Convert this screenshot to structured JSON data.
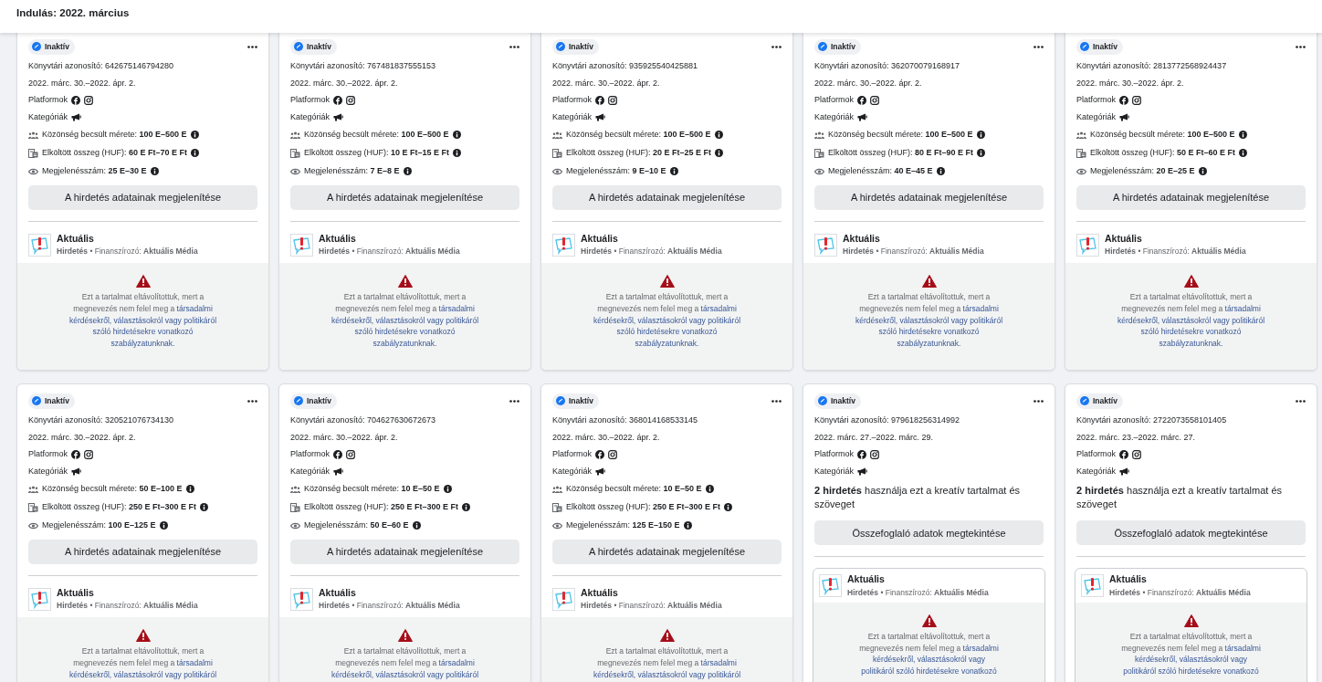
{
  "header": {
    "title": "Indulás: 2022. március"
  },
  "cards": [
    {
      "kind": "details",
      "status": "Inaktív",
      "library_id": "Könyvtári azonosító: 642675146794280",
      "dates": "2022. márc. 30.–2022. ápr. 2.",
      "platforms_label": "Platformok",
      "categories_label": "Kategóriák",
      "metrics": [
        {
          "kind": "audience",
          "text": "Közönség becsült mérete: **100 E–500 E**"
        },
        {
          "kind": "spend",
          "text": "Elköltött összeg (HUF): **60 E Ft–70 E Ft**"
        },
        {
          "kind": "impressions",
          "text": "Megjelenésszám: **25 E–30 E**"
        }
      ],
      "button": "A hirdetés adatainak megjelenítése",
      "advertiser": {
        "name": "Aktuális",
        "line": "**Hirdetés** • Finanszírozó: **Aktuális Média**"
      },
      "notice": [
        {
          "text": "Ezt a tartalmat eltávolítottuk, mert a"
        },
        {
          "text": "megnevezés nem felel meg a",
          "link": "társadalmi"
        },
        {
          "link": "kérdésekről, választásokról vagy politikáról"
        },
        {
          "link": "szóló hirdetésekre vonatkozó"
        },
        {
          "link": "szabályzatunknak."
        }
      ]
    },
    {
      "kind": "details",
      "status": "Inaktív",
      "library_id": "Könyvtári azonosító: 767481837555153",
      "dates": "2022. márc. 30.–2022. ápr. 2.",
      "platforms_label": "Platformok",
      "categories_label": "Kategóriák",
      "metrics": [
        {
          "kind": "audience",
          "text": "Közönség becsült mérete: **100 E–500 E**"
        },
        {
          "kind": "spend",
          "text": "Elköltött összeg (HUF): **10 E Ft–15 E Ft**"
        },
        {
          "kind": "impressions",
          "text": "Megjelenésszám: **7 E–8 E**"
        }
      ],
      "button": "A hirdetés adatainak megjelenítése",
      "advertiser": {
        "name": "Aktuális",
        "line": "**Hirdetés** • Finanszírozó: **Aktuális Média**"
      },
      "notice": [
        {
          "text": "Ezt a tartalmat eltávolítottuk, mert a"
        },
        {
          "text": "megnevezés nem felel meg a",
          "link": "társadalmi"
        },
        {
          "link": "kérdésekről, választásokról vagy politikáról"
        },
        {
          "link": "szóló hirdetésekre vonatkozó"
        },
        {
          "link": "szabályzatunknak."
        }
      ]
    },
    {
      "kind": "details",
      "status": "Inaktív",
      "library_id": "Könyvtári azonosító: 935925540425881",
      "dates": "2022. márc. 30.–2022. ápr. 2.",
      "platforms_label": "Platformok",
      "categories_label": "Kategóriák",
      "metrics": [
        {
          "kind": "audience",
          "text": "Közönség becsült mérete: **100 E–500 E**"
        },
        {
          "kind": "spend",
          "text": "Elköltött összeg (HUF): **20 E Ft–25 E Ft**"
        },
        {
          "kind": "impressions",
          "text": "Megjelenésszám: **9 E–10 E**"
        }
      ],
      "button": "A hirdetés adatainak megjelenítése",
      "advertiser": {
        "name": "Aktuális",
        "line": "**Hirdetés** • Finanszírozó: **Aktuális Média**"
      },
      "notice": [
        {
          "text": "Ezt a tartalmat eltávolítottuk, mert a"
        },
        {
          "text": "megnevezés nem felel meg a",
          "link": "társadalmi"
        },
        {
          "link": "kérdésekről, választásokról vagy politikáról"
        },
        {
          "link": "szóló hirdetésekre vonatkozó"
        },
        {
          "link": "szabályzatunknak."
        }
      ]
    },
    {
      "kind": "details",
      "status": "Inaktív",
      "library_id": "Könyvtári azonosító: 362070079168917",
      "dates": "2022. márc. 30.–2022. ápr. 2.",
      "platforms_label": "Platformok",
      "categories_label": "Kategóriák",
      "metrics": [
        {
          "kind": "audience",
          "text": "Közönség becsült mérete: **100 E–500 E**"
        },
        {
          "kind": "spend",
          "text": "Elköltött összeg (HUF): **80 E Ft–90 E Ft**"
        },
        {
          "kind": "impressions",
          "text": "Megjelenésszám: **40 E–45 E**"
        }
      ],
      "button": "A hirdetés adatainak megjelenítése",
      "advertiser": {
        "name": "Aktuális",
        "line": "**Hirdetés** • Finanszírozó: **Aktuális Média**"
      },
      "notice": [
        {
          "text": "Ezt a tartalmat eltávolítottuk, mert a"
        },
        {
          "text": "megnevezés nem felel meg a",
          "link": "társadalmi"
        },
        {
          "link": "kérdésekről, választásokról vagy politikáról"
        },
        {
          "link": "szóló hirdetésekre vonatkozó"
        },
        {
          "link": "szabályzatunknak."
        }
      ]
    },
    {
      "kind": "details",
      "status": "Inaktív",
      "library_id": "Könyvtári azonosító: 2813772568924437",
      "dates": "2022. márc. 30.–2022. ápr. 2.",
      "platforms_label": "Platformok",
      "categories_label": "Kategóriák",
      "metrics": [
        {
          "kind": "audience",
          "text": "Közönség becsült mérete: **100 E–500 E**"
        },
        {
          "kind": "spend",
          "text": "Elköltött összeg (HUF): **50 E Ft–60 E Ft**"
        },
        {
          "kind": "impressions",
          "text": "Megjelenésszám: **20 E–25 E**"
        }
      ],
      "button": "A hirdetés adatainak megjelenítése",
      "advertiser": {
        "name": "Aktuális",
        "line": "**Hirdetés** • Finanszírozó: **Aktuális Média**"
      },
      "notice": [
        {
          "text": "Ezt a tartalmat eltávolítottuk, mert a"
        },
        {
          "text": "megnevezés nem felel meg a",
          "link": "társadalmi"
        },
        {
          "link": "kérdésekről, választásokról vagy politikáról"
        },
        {
          "link": "szóló hirdetésekre vonatkozó"
        },
        {
          "link": "szabályzatunknak."
        }
      ]
    },
    {
      "kind": "details",
      "status": "Inaktív",
      "library_id": "Könyvtári azonosító: 320521076734130",
      "dates": "2022. márc. 30.–2022. ápr. 2.",
      "platforms_label": "Platformok",
      "categories_label": "Kategóriák",
      "metrics": [
        {
          "kind": "audience",
          "text": "Közönség becsült mérete: **50 E–100 E**"
        },
        {
          "kind": "spend",
          "text": "Elköltött összeg (HUF): **250 E Ft–300 E Ft**"
        },
        {
          "kind": "impressions",
          "text": "Megjelenésszám: **100 E–125 E**"
        }
      ],
      "button": "A hirdetés adatainak megjelenítése",
      "advertiser": {
        "name": "Aktuális",
        "line": "**Hirdetés** • Finanszírozó: **Aktuális Média**"
      },
      "notice": [
        {
          "text": "Ezt a tartalmat eltávolítottuk, mert a"
        },
        {
          "text": "megnevezés nem felel meg a",
          "link": "társadalmi"
        },
        {
          "link": "kérdésekről, választásokról vagy politikáról"
        }
      ]
    },
    {
      "kind": "details",
      "status": "Inaktív",
      "library_id": "Könyvtári azonosító: 704627630672673",
      "dates": "2022. márc. 30.–2022. ápr. 2.",
      "platforms_label": "Platformok",
      "categories_label": "Kategóriák",
      "metrics": [
        {
          "kind": "audience",
          "text": "Közönség becsült mérete: **10 E–50 E**"
        },
        {
          "kind": "spend",
          "text": "Elköltött összeg (HUF): **250 E Ft–300 E Ft**"
        },
        {
          "kind": "impressions",
          "text": "Megjelenésszám: **50 E–60 E**"
        }
      ],
      "button": "A hirdetés adatainak megjelenítése",
      "advertiser": {
        "name": "Aktuális",
        "line": "**Hirdetés** • Finanszírozó: **Aktuális Média**"
      },
      "notice": [
        {
          "text": "Ezt a tartalmat eltávolítottuk, mert a"
        },
        {
          "text": "megnevezés nem felel meg a",
          "link": "társadalmi"
        },
        {
          "link": "kérdésekről, választásokról vagy politikáról"
        }
      ]
    },
    {
      "kind": "details",
      "status": "Inaktív",
      "library_id": "Könyvtári azonosító: 368014168533145",
      "dates": "2022. márc. 30.–2022. ápr. 2.",
      "platforms_label": "Platformok",
      "categories_label": "Kategóriák",
      "metrics": [
        {
          "kind": "audience",
          "text": "Közönség becsült mérete: **10 E–50 E**"
        },
        {
          "kind": "spend",
          "text": "Elköltött összeg (HUF): **250 E Ft–300 E Ft**"
        },
        {
          "kind": "impressions",
          "text": "Megjelenésszám: **125 E–150 E**"
        }
      ],
      "button": "A hirdetés adatainak megjelenítése",
      "advertiser": {
        "name": "Aktuális",
        "line": "**Hirdetés** • Finanszírozó: **Aktuális Média**"
      },
      "notice": [
        {
          "text": "Ezt a tartalmat eltávolítottuk, mert a"
        },
        {
          "text": "megnevezés nem felel meg a",
          "link": "társadalmi"
        },
        {
          "link": "kérdésekről, választásokról vagy politikáról"
        }
      ]
    },
    {
      "kind": "summary",
      "status": "Inaktív",
      "library_id": "Könyvtári azonosító: 979618256314992",
      "dates": "2022. márc. 27.–2022. márc. 29.",
      "platforms_label": "Platformok",
      "categories_label": "Kategóriák",
      "usage": "**2 hirdetés** használja ezt a kreatív tartalmat és szöveget",
      "button": "Összefoglaló adatok megtekintése",
      "advertiser": {
        "name": "Aktuális",
        "line": "**Hirdetés** • Finanszírozó: **Aktuális Média**"
      },
      "notice": [
        {
          "text": "Ezt a tartalmat eltávolítottuk, mert a"
        },
        {
          "text": "megnevezés nem felel meg a",
          "link": "társadalmi"
        },
        {
          "link": "kérdésekről, választásokról vagy"
        },
        {
          "link": "politikáról szóló hirdetésekre vonatkozó"
        }
      ]
    },
    {
      "kind": "summary",
      "status": "Inaktív",
      "library_id": "Könyvtári azonosító: 2722073558101405",
      "dates": "2022. márc. 23.–2022. márc. 27.",
      "platforms_label": "Platformok",
      "categories_label": "Kategóriák",
      "usage": "**2 hirdetés** használja ezt a kreatív tartalmat és szöveget",
      "button": "Összefoglaló adatok megtekintése",
      "advertiser": {
        "name": "Aktuális",
        "line": "**Hirdetés** • Finanszírozó: **Aktuális Média**"
      },
      "notice": [
        {
          "text": "Ezt a tartalmat eltávolítottuk, mert a"
        },
        {
          "text": "megnevezés nem felel meg a",
          "link": "társadalmi"
        },
        {
          "link": "kérdésekről, választásokról vagy"
        },
        {
          "link": "politikáról szóló hirdetésekre vonatkozó"
        }
      ]
    }
  ]
}
